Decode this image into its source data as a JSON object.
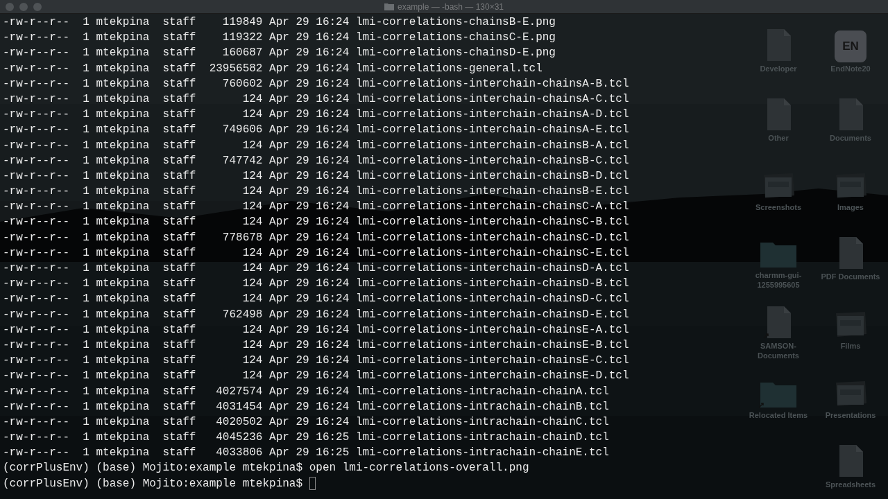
{
  "window": {
    "title": "example — -bash — 130×31"
  },
  "lines": [
    "-rw-r--r--  1 mtekpina  staff    119849 Apr 29 16:24 lmi-correlations-chainsB-E.png",
    "-rw-r--r--  1 mtekpina  staff    119322 Apr 29 16:24 lmi-correlations-chainsC-E.png",
    "-rw-r--r--  1 mtekpina  staff    160687 Apr 29 16:24 lmi-correlations-chainsD-E.png",
    "-rw-r--r--  1 mtekpina  staff  23956582 Apr 29 16:24 lmi-correlations-general.tcl",
    "-rw-r--r--  1 mtekpina  staff    760602 Apr 29 16:24 lmi-correlations-interchain-chainsA-B.tcl",
    "-rw-r--r--  1 mtekpina  staff       124 Apr 29 16:24 lmi-correlations-interchain-chainsA-C.tcl",
    "-rw-r--r--  1 mtekpina  staff       124 Apr 29 16:24 lmi-correlations-interchain-chainsA-D.tcl",
    "-rw-r--r--  1 mtekpina  staff    749606 Apr 29 16:24 lmi-correlations-interchain-chainsA-E.tcl",
    "-rw-r--r--  1 mtekpina  staff       124 Apr 29 16:24 lmi-correlations-interchain-chainsB-A.tcl",
    "-rw-r--r--  1 mtekpina  staff    747742 Apr 29 16:24 lmi-correlations-interchain-chainsB-C.tcl",
    "-rw-r--r--  1 mtekpina  staff       124 Apr 29 16:24 lmi-correlations-interchain-chainsB-D.tcl",
    "-rw-r--r--  1 mtekpina  staff       124 Apr 29 16:24 lmi-correlations-interchain-chainsB-E.tcl",
    "-rw-r--r--  1 mtekpina  staff       124 Apr 29 16:24 lmi-correlations-interchain-chainsC-A.tcl",
    "-rw-r--r--  1 mtekpina  staff       124 Apr 29 16:24 lmi-correlations-interchain-chainsC-B.tcl",
    "-rw-r--r--  1 mtekpina  staff    778678 Apr 29 16:24 lmi-correlations-interchain-chainsC-D.tcl",
    "-rw-r--r--  1 mtekpina  staff       124 Apr 29 16:24 lmi-correlations-interchain-chainsC-E.tcl",
    "-rw-r--r--  1 mtekpina  staff       124 Apr 29 16:24 lmi-correlations-interchain-chainsD-A.tcl",
    "-rw-r--r--  1 mtekpina  staff       124 Apr 29 16:24 lmi-correlations-interchain-chainsD-B.tcl",
    "-rw-r--r--  1 mtekpina  staff       124 Apr 29 16:24 lmi-correlations-interchain-chainsD-C.tcl",
    "-rw-r--r--  1 mtekpina  staff    762498 Apr 29 16:24 lmi-correlations-interchain-chainsD-E.tcl",
    "-rw-r--r--  1 mtekpina  staff       124 Apr 29 16:24 lmi-correlations-interchain-chainsE-A.tcl",
    "-rw-r--r--  1 mtekpina  staff       124 Apr 29 16:24 lmi-correlations-interchain-chainsE-B.tcl",
    "-rw-r--r--  1 mtekpina  staff       124 Apr 29 16:24 lmi-correlations-interchain-chainsE-C.tcl",
    "-rw-r--r--  1 mtekpina  staff       124 Apr 29 16:24 lmi-correlations-interchain-chainsE-D.tcl",
    "-rw-r--r--  1 mtekpina  staff   4027574 Apr 29 16:24 lmi-correlations-intrachain-chainA.tcl",
    "-rw-r--r--  1 mtekpina  staff   4031454 Apr 29 16:24 lmi-correlations-intrachain-chainB.tcl",
    "-rw-r--r--  1 mtekpina  staff   4020502 Apr 29 16:24 lmi-correlations-intrachain-chainC.tcl",
    "-rw-r--r--  1 mtekpina  staff   4045236 Apr 29 16:25 lmi-correlations-intrachain-chainD.tcl",
    "-rw-r--r--  1 mtekpina  staff   4033806 Apr 29 16:25 lmi-correlations-intrachain-chainE.tcl",
    "(corrPlusEnv) (base) Mojito:example mtekpina$ open lmi-correlations-overall.png",
    "(corrPlusEnv) (base) Mojito:example mtekpina$ "
  ],
  "desktop_columns": [
    {
      "icons": [
        {
          "label": "Developer",
          "kind": "document"
        },
        {
          "label": "Other",
          "kind": "document"
        },
        {
          "label": "Screenshots",
          "kind": "stack"
        },
        {
          "label": "charmm-gui-1255995605",
          "kind": "folder"
        },
        {
          "label": "SAMSON-Documents",
          "kind": "alias-document"
        },
        {
          "label": "Relocated Items",
          "kind": "alias-folder"
        }
      ]
    },
    {
      "icons": [
        {
          "label": "EndNote20",
          "kind": "app",
          "badge": "EN"
        },
        {
          "label": "Documents",
          "kind": "document"
        },
        {
          "label": "Images",
          "kind": "stack"
        },
        {
          "label": "PDF Documents",
          "kind": "document"
        },
        {
          "label": "Films",
          "kind": "stack"
        },
        {
          "label": "Presentations",
          "kind": "stack"
        },
        {
          "label": "Spreadsheets",
          "kind": "document"
        }
      ]
    }
  ]
}
